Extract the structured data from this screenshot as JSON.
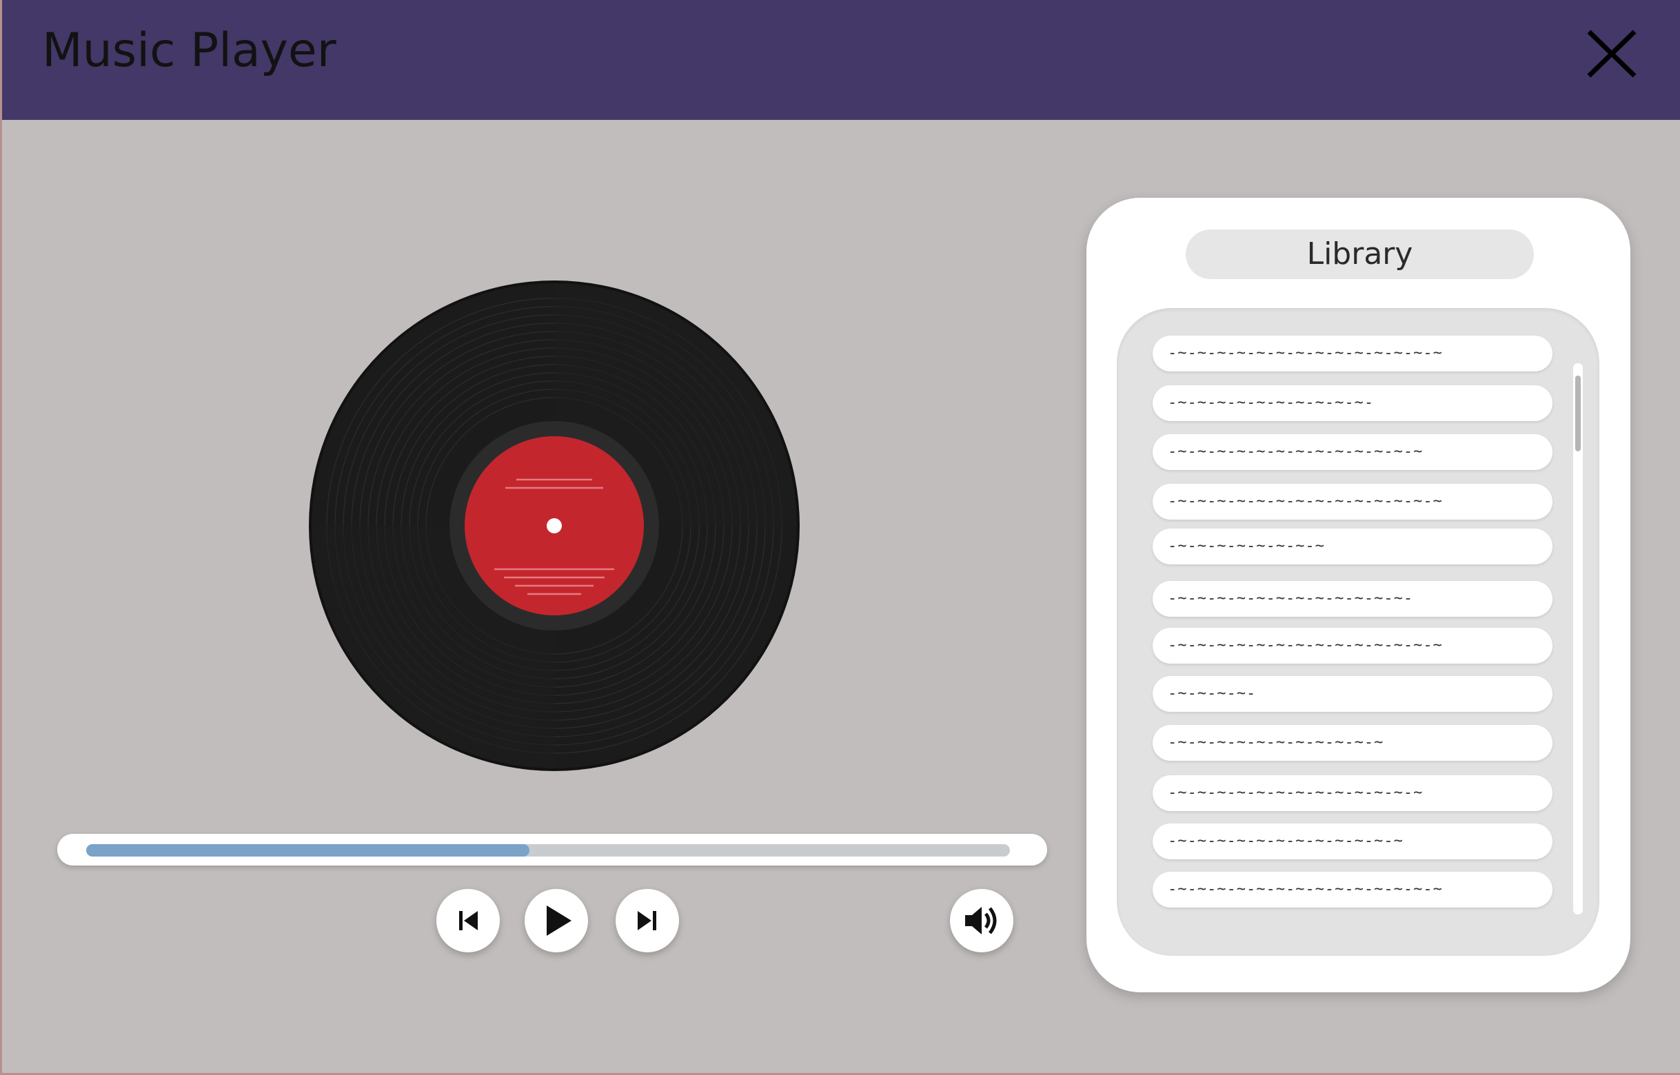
{
  "window": {
    "title": "Music Player",
    "colors": {
      "titlebar": "#433867",
      "background": "#c1bdbc",
      "label": "#c4262e",
      "vinyl": "#1b1b1b",
      "progress_fill": "#7ba3c8"
    }
  },
  "player": {
    "progress_fraction": 0.48,
    "controls": {
      "previous_icon": "skip-previous-icon",
      "play_icon": "play-icon",
      "next_icon": "skip-next-icon",
      "volume_icon": "volume-icon"
    }
  },
  "library": {
    "title": "Library",
    "tracks": [
      "-~-~-~-~-~-~-~-~-~-~-~-~-~-~",
      "-~-~-~-~-~-~-~-~-~-~-",
      "-~-~-~-~-~-~-~-~-~-~-~-~-~",
      "-~-~-~-~-~-~-~-~-~-~-~-~-~-~",
      "-~-~-~-~-~-~-~-~",
      "-~-~-~-~-~-~-~-~-~-~-~-~-",
      "-~-~-~-~-~-~-~-~-~-~-~-~-~-~",
      "-~-~-~-~-",
      "-~-~-~-~-~-~-~-~-~-~-~",
      "-~-~-~-~-~-~-~-~-~-~-~-~-~",
      "-~-~-~-~-~-~-~-~-~-~-~-~",
      "-~-~-~-~-~-~-~-~-~-~-~-~-~-~"
    ]
  }
}
